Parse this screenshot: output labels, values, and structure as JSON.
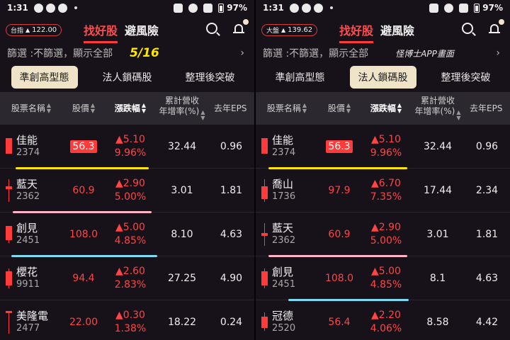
{
  "colors": {
    "accent": "#ff3b3b",
    "yellow": "#ffe600",
    "pink": "#ffb3c6",
    "blue": "#7ddcf0",
    "activeChip": "#efe3c8"
  },
  "panels": [
    {
      "status": {
        "time": "1:31",
        "battery": "97%"
      },
      "index": {
        "label": "台指",
        "value": "122.00"
      },
      "top_tabs": [
        "找好股",
        "避風險"
      ],
      "filter": {
        "text": "篩選 :不篩選，顯示全部",
        "annotation": "5/16",
        "watermark": ""
      },
      "strategy_tabs": [
        "準創高型態",
        "法人鎖碼股",
        "整理後突破"
      ],
      "active_strategy": 0,
      "columns": {
        "name": "股票名稱",
        "price": "股價",
        "chg": "漲跌幅",
        "rev1": "累計營收",
        "rev2": "年增率(%)",
        "eps": "去年EPS"
      },
      "rows": [
        {
          "name": "佳能",
          "code": "2374",
          "price": "56.3",
          "chg": "5.10",
          "pct": "9.96%",
          "rev": "32.44",
          "eps": "0.96",
          "hl": true
        },
        {
          "name": "藍天",
          "code": "2362",
          "price": "60.9",
          "chg": "2.90",
          "pct": "5.00%",
          "rev": "3.01",
          "eps": "1.81",
          "hl": false
        },
        {
          "name": "創見",
          "code": "2451",
          "price": "108.0",
          "chg": "5.00",
          "pct": "4.85%",
          "rev": "8.10",
          "eps": "4.63",
          "hl": false
        },
        {
          "name": "櫻花",
          "code": "9911",
          "price": "94.4",
          "chg": "2.60",
          "pct": "2.83%",
          "rev": "27.25",
          "eps": "4.90",
          "hl": false
        },
        {
          "name": "美隆電",
          "code": "2477",
          "price": "22.00",
          "chg": "0.30",
          "pct": "1.38%",
          "rev": "18.22",
          "eps": "0.24",
          "hl": false
        }
      ]
    },
    {
      "status": {
        "time": "1:31",
        "battery": "97%"
      },
      "index": {
        "label": "大盤",
        "value": "139.62"
      },
      "top_tabs": [
        "找好股",
        "避風險"
      ],
      "filter": {
        "text": "篩選 :不篩選，顯示全部",
        "annotation": "",
        "watermark": "怪博士APP畫面"
      },
      "strategy_tabs": [
        "準創高型態",
        "法人鎖碼股",
        "整理後突破"
      ],
      "active_strategy": 1,
      "columns": {
        "name": "股票名稱",
        "price": "股價",
        "chg": "漲跌幅",
        "rev1": "累計營收",
        "rev2": "年增率(%)",
        "eps": "去年EPS"
      },
      "rows": [
        {
          "name": "佳能",
          "code": "2374",
          "price": "56.3",
          "chg": "5.10",
          "pct": "9.96%",
          "rev": "32.44",
          "eps": "0.96",
          "hl": true
        },
        {
          "name": "喬山",
          "code": "1736",
          "price": "97.9",
          "chg": "6.70",
          "pct": "7.35%",
          "rev": "17.44",
          "eps": "2.34",
          "hl": false
        },
        {
          "name": "藍天",
          "code": "2362",
          "price": "60.9",
          "chg": "2.90",
          "pct": "5.00%",
          "rev": "3.01",
          "eps": "1.81",
          "hl": false
        },
        {
          "name": "創見",
          "code": "2451",
          "price": "108.0",
          "chg": "5.00",
          "pct": "4.85%",
          "rev": "8.1",
          "eps": "4.63",
          "hl": false
        },
        {
          "name": "冠德",
          "code": "2520",
          "price": "56.4",
          "chg": "2.20",
          "pct": "4.06%",
          "rev": "8.58",
          "eps": "4.42",
          "hl": false
        }
      ]
    }
  ]
}
